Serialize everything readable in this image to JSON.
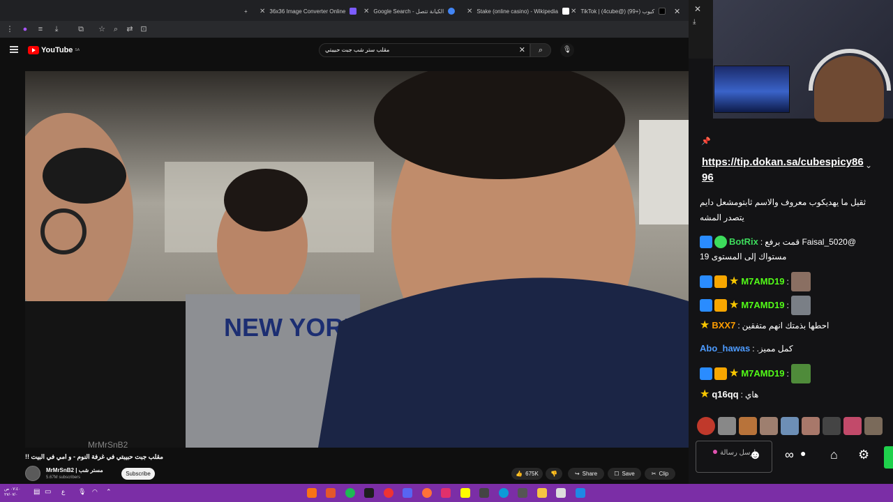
{
  "browser": {
    "tabs": [
      {
        "title": "36x36 Image Converter Online",
        "color": "#7c5cff"
      },
      {
        "title": "Google Search - الكيانة تتصل",
        "color": "#4285f4"
      },
      {
        "title": "Stake (online casino) - Wikipedia",
        "color": "#ffffff"
      },
      {
        "title": "TikTok | (4cube@) كيوب (+99)",
        "color": "#000000"
      }
    ]
  },
  "youtube": {
    "logo_text": "YouTube",
    "logo_region": "SA",
    "search_value": "مقلب ستر شب جبت حبيبتي",
    "video_title": "مقلب جبت حبيبتي في غرفة النوم - و امي في البيت !!",
    "channel_name": "MrMrSnB2 | مستر شب",
    "subscribers": "5.67M subscribers",
    "subscribe_label": "Subscribe",
    "likes": "675K",
    "share_label": "Share",
    "save_label": "Save",
    "clip_label": "Clip",
    "watermark": "MrMrSnB2"
  },
  "chat": {
    "pinned_link": "https://tip.dokan.sa/cubespicy8696",
    "partial_line_1": "ثقيل ما يهديكوب معروف والاسم ثابتومشعل دايم",
    "partial_line_2": "يتصدر المشه",
    "messages": [
      {
        "user": "BotRix",
        "user_color": "#3ddc5c",
        "text": "@Faisal_5020 قمت برفع",
        "text2": "مستواك إلى المستوى 19"
      },
      {
        "user": "M7AMD19",
        "user_color": "#53fc18",
        "text": ""
      },
      {
        "user": "M7AMD19",
        "user_color": "#53fc18",
        "text": ""
      },
      {
        "user": "BXX7",
        "user_color": "#ff9d00",
        "text": "احطها بذمتك انهم متفقين"
      },
      {
        "user": "Abo_hawas",
        "user_color": "#4d9bff",
        "text": "كمل مميز."
      },
      {
        "user": "M7AMD19",
        "user_color": "#53fc18",
        "text": ""
      },
      {
        "user": "q16qq",
        "user_color": "#ffffff",
        "text": "هاي"
      }
    ],
    "input_placeholder": "ارسل رسالة"
  },
  "taskbar": {
    "time": "٠٧:٤٠ ص",
    "date": "٢٧/٠٧/٠"
  }
}
